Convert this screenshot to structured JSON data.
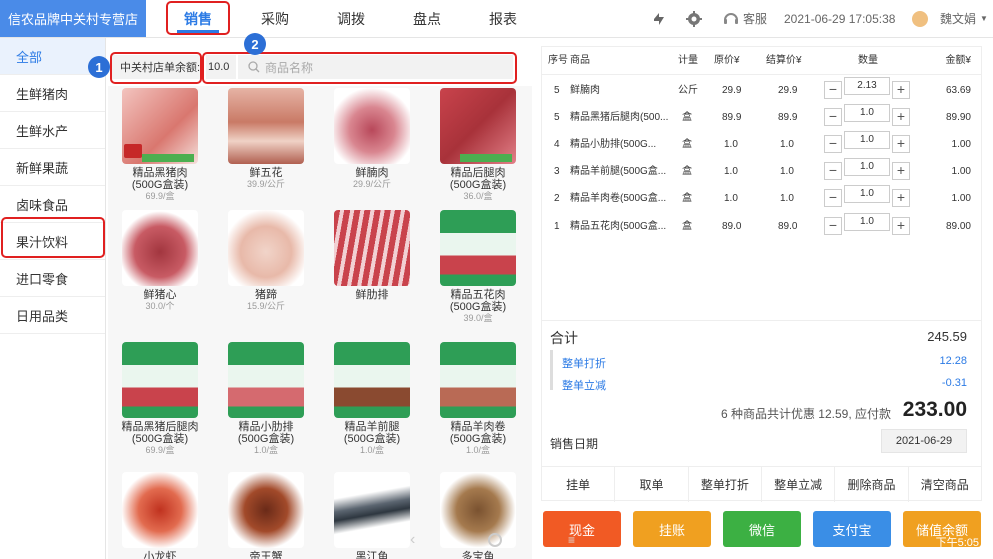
{
  "header": {
    "store_title": "信农品牌中关村专营店",
    "tabs": [
      "销售",
      "采购",
      "调拨",
      "盘点",
      "报表"
    ],
    "support": "客服",
    "datetime": "2021-06-29 17:05:38",
    "user": "魏文娟"
  },
  "sidebar": {
    "items": [
      "全部",
      "生鲜猪肉",
      "生鲜水产",
      "新鲜果蔬",
      "卤味食品",
      "果汁饮料",
      "进口零食",
      "日用品类"
    ]
  },
  "search": {
    "store_label": "中关村店单余额:",
    "balance": "10.0",
    "placeholder": "商品名称"
  },
  "annotations": {
    "one": "1",
    "two": "2"
  },
  "products": [
    {
      "name": "精品黑猪肉(500G盒装)",
      "price": "69.9/盒"
    },
    {
      "name": "鲜五花",
      "price": "39.9/公斤"
    },
    {
      "name": "鲜腩肉",
      "price": "29.9/公斤"
    },
    {
      "name": "精品后腿肉(500G盒装)",
      "price": "36.0/盒"
    },
    {
      "name": "鲜猪心",
      "price": "30.0/个"
    },
    {
      "name": "猪蹄",
      "price": "15.9/公斤"
    },
    {
      "name": "鲜肋排",
      "price": ""
    },
    {
      "name": "精品五花肉(500G盒装)",
      "price": "39.0/盒"
    },
    {
      "name": "精品黑猪后腿肉(500G盒装)",
      "price": "69.9/盒"
    },
    {
      "name": "精品小肋排(500G盒装)",
      "price": "1.0/盒"
    },
    {
      "name": "精品羊前腿(500G盒装)",
      "price": "1.0/盒"
    },
    {
      "name": "精品羊肉卷(500G盒装)",
      "price": "1.0/盒"
    },
    {
      "name": "小龙虾",
      "price": ""
    },
    {
      "name": "帝王蟹",
      "price": ""
    },
    {
      "name": "黑江鱼",
      "price": ""
    },
    {
      "name": "多宝鱼",
      "price": ""
    }
  ],
  "cart": {
    "headers": [
      "序号",
      "商品",
      "计量",
      "原价¥",
      "结算价¥",
      "数量",
      "金额¥"
    ],
    "rows": [
      {
        "no": "5",
        "name": "鲜腩肉",
        "unit": "公斤",
        "orig": "29.9",
        "settle": "29.9",
        "qty": "2.13",
        "amount": "63.69"
      },
      {
        "no": "5",
        "name": "精品黑猪后腿肉(500...",
        "unit": "盒",
        "orig": "89.9",
        "settle": "89.9",
        "qty": "1.0",
        "amount": "89.90"
      },
      {
        "no": "4",
        "name": "精品小肋排(500G...",
        "unit": "盒",
        "orig": "1.0",
        "settle": "1.0",
        "qty": "1.0",
        "amount": "1.00"
      },
      {
        "no": "3",
        "name": "精品羊前腿(500G盒...",
        "unit": "盒",
        "orig": "1.0",
        "settle": "1.0",
        "qty": "1.0",
        "amount": "1.00"
      },
      {
        "no": "2",
        "name": "精品羊肉卷(500G盒...",
        "unit": "盒",
        "orig": "1.0",
        "settle": "1.0",
        "qty": "1.0",
        "amount": "1.00"
      },
      {
        "no": "1",
        "name": "精品五花肉(500G盒...",
        "unit": "盒",
        "orig": "89.0",
        "settle": "89.0",
        "qty": "1.0",
        "amount": "89.00"
      }
    ],
    "total_label": "合计",
    "total": "245.59",
    "discount_label": "整单打折",
    "discount": "12.28",
    "reduce_label": "整单立减",
    "reduce": "-0.31",
    "summary": "6 种商品共计优惠 12.59, 应付款",
    "payable": "233.00",
    "date_label": "销售日期",
    "date": "2021-06-29",
    "actions": [
      "挂单",
      "取单",
      "整单打折",
      "整单立减",
      "删除商品",
      "清空商品"
    ]
  },
  "pay_buttons": [
    "现金",
    "挂账",
    "微信",
    "支付宝",
    "储值余额"
  ],
  "status": {
    "time": "下午5:05"
  }
}
